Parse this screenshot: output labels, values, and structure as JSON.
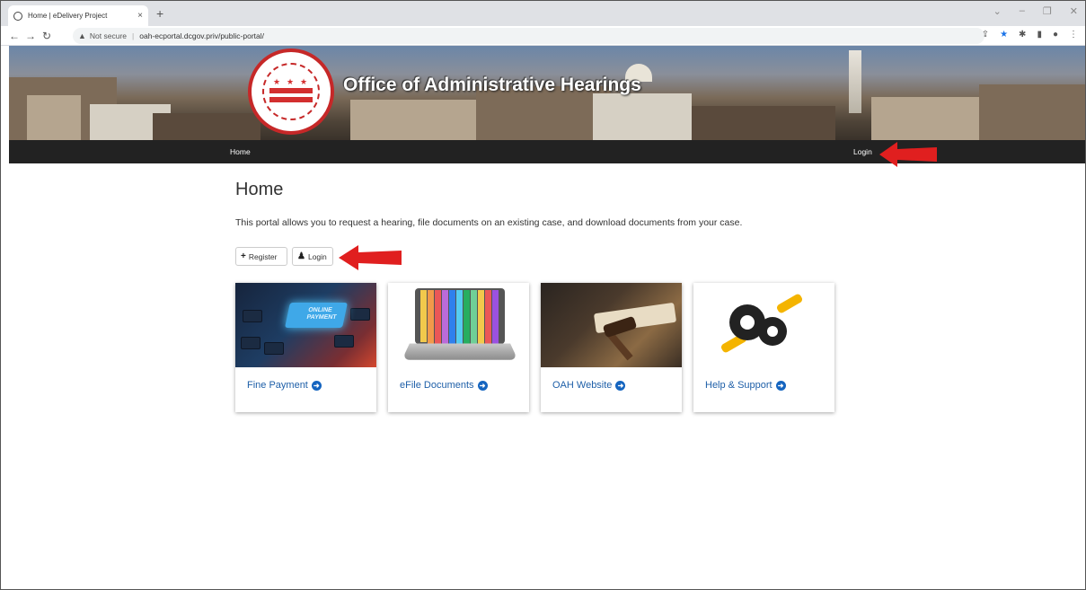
{
  "browser": {
    "tab_title": "Home | eDelivery Project",
    "tab_close": "×",
    "new_tab": "+",
    "security_label": "Not secure",
    "url": "oah-ecportal.dcgov.priv/public-portal/"
  },
  "banner": {
    "title": "Office of Administrative Hearings"
  },
  "nav": {
    "home": "Home",
    "login": "Login"
  },
  "main": {
    "title": "Home",
    "intro": "This portal allows you to request a hearing, file documents on an existing case, and download documents from your case.",
    "register_label": "Register",
    "login_label": "Login"
  },
  "cards": [
    {
      "label": "Fine Payment",
      "image_text": "ONLINE PAYMENT"
    },
    {
      "label": "eFile Documents"
    },
    {
      "label": "OAH Website"
    },
    {
      "label": "Help & Support"
    }
  ],
  "colors": {
    "nav_bg": "#222222",
    "link": "#1e5fa8",
    "annotation_arrow": "#e01f1f"
  }
}
